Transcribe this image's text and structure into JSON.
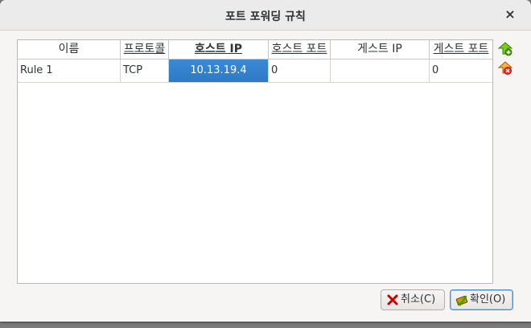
{
  "dialog": {
    "title": "포트 포워딩 규칙",
    "close_label": "×"
  },
  "table": {
    "headers": [
      "이름",
      "프로토콜",
      "호스트 IP",
      "호스트 포트",
      "게스트 IP",
      "게스트 포트"
    ],
    "rows": [
      [
        "Rule 1",
        "TCP",
        "10.13.19.4",
        "0",
        "",
        "0"
      ]
    ]
  },
  "side_buttons": {
    "add": "add-rule-icon",
    "remove": "remove-rule-icon"
  },
  "buttons": {
    "cancel_label": "취소(C)",
    "ok_label": "확인(O)"
  },
  "colors": {
    "selection": "#3584e4",
    "add_icon": "#4e9a06",
    "remove_icon": "#cc0000"
  }
}
